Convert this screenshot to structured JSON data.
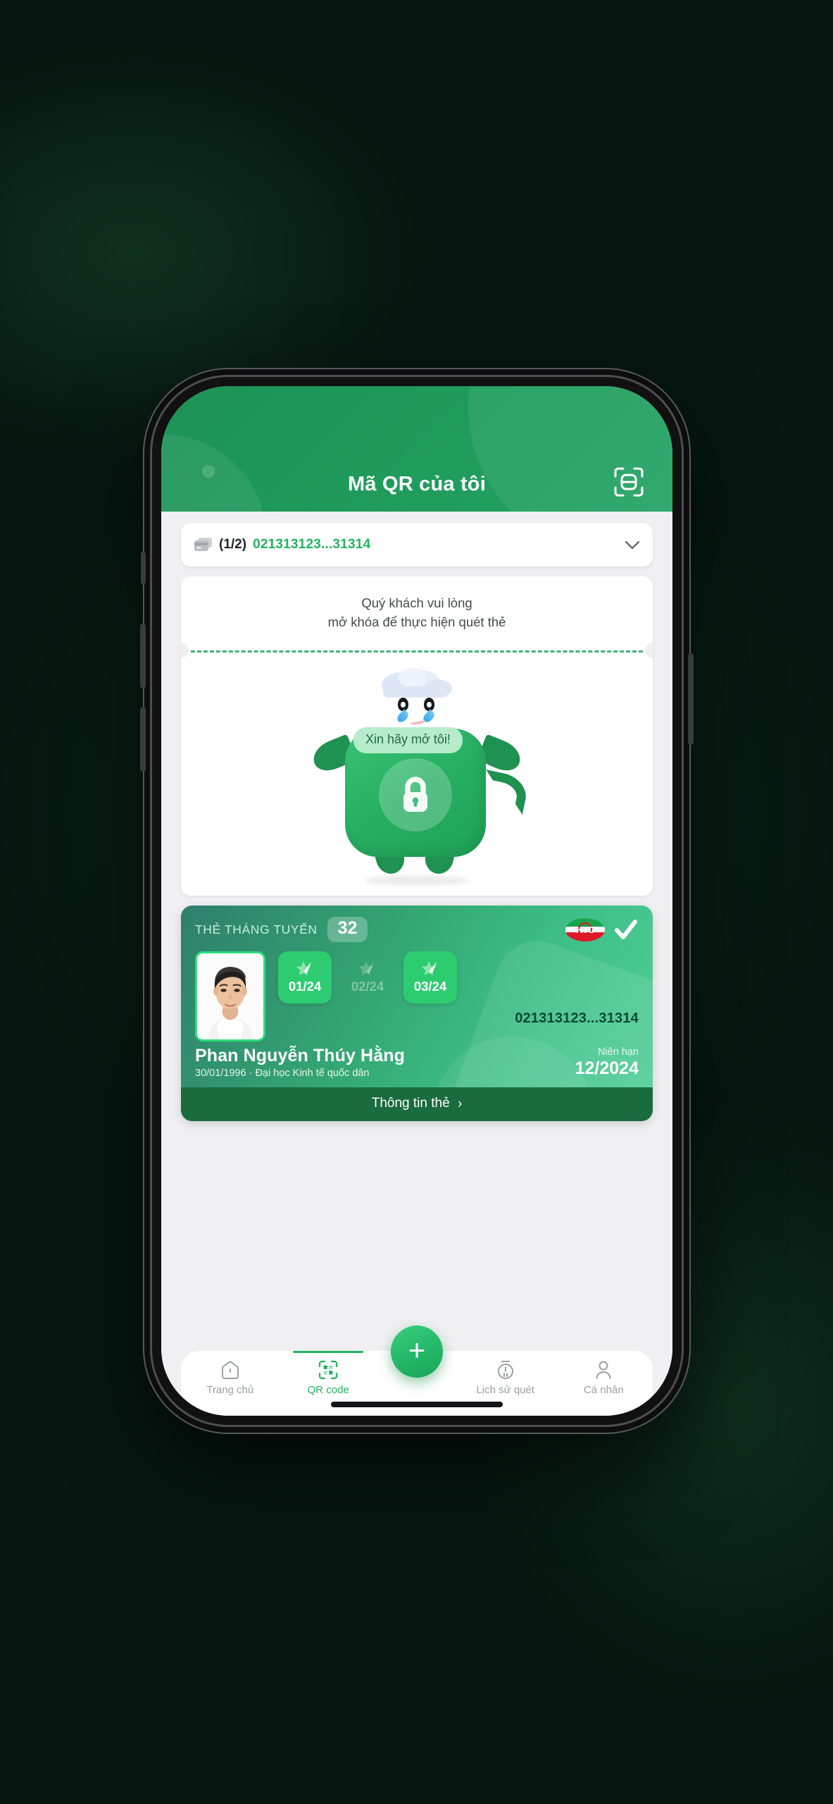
{
  "header": {
    "title": "Mã QR của tôi",
    "scan_icon": "scan-frame-icon"
  },
  "selector": {
    "card_icon": "stacked-cards-icon",
    "count": "(1/2)",
    "card_number": "021313123...31314",
    "chevron_icon": "chevron-down-icon"
  },
  "locked_panel": {
    "message_line1": "Quý khách vui lòng",
    "message_line2": "mở khóa để thực hiện quét thẻ",
    "bubble_text": "Xin hãy mở tôi!",
    "mascot_icon": "locked-mascot-illustration",
    "lock_icon": "lock-icon",
    "cloud_icon": "rain-cloud-icon"
  },
  "member_card": {
    "type_label": "THẺ THÁNG TUYẾN",
    "route_badge": "32",
    "operator_logo": "htc-oval-logo",
    "operator_logo_text": "HTC",
    "verified_icon": "check-mark-icon",
    "photo_icon": "student-portrait-photo",
    "months": [
      {
        "label": "01/24",
        "active": true,
        "icon": "ticket-star-icon"
      },
      {
        "label": "02/24",
        "active": false,
        "icon": "ticket-star-icon"
      },
      {
        "label": "03/24",
        "active": true,
        "icon": "ticket-star-icon"
      }
    ],
    "card_number": "021313123...31314",
    "name": "Phan Nguyễn Thúy Hằng",
    "subtitle": "30/01/1996 · Đại học Kinh tế quốc dân",
    "expiry_label": "Niên hạn",
    "expiry_value": "12/2024",
    "footer_label": "Thông tin thẻ",
    "footer_chevron": "›"
  },
  "bottom_nav": {
    "items": [
      {
        "label": "Trang chủ",
        "icon": "home-icon",
        "active": false
      },
      {
        "label": "QR code",
        "icon": "qr-code-icon",
        "active": true
      },
      {
        "label": "Lịch sử quét",
        "icon": "scan-history-timer-icon",
        "active": false
      },
      {
        "label": "Cá nhân",
        "icon": "person-icon",
        "active": false
      }
    ],
    "fab_label": "+",
    "fab_icon": "plus-icon"
  },
  "colors": {
    "brand_green": "#22b35e",
    "header_green": "#1f9a5b",
    "card_footer_green": "#1a6b3d",
    "muted_text": "#9aa0a6",
    "dark_bg": "#051410"
  }
}
